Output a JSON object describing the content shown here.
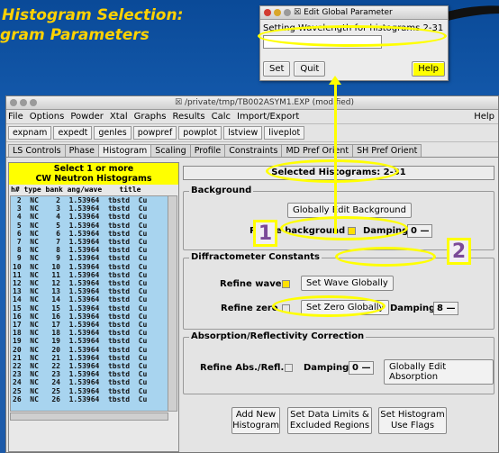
{
  "slide": {
    "title_line1": "Histogram Selection:",
    "title_line2": "gram Parameters"
  },
  "dialog": {
    "window_title": "Edit Global Parameter",
    "message": "Setting Wavelength for histograms 2-31",
    "input_value": "",
    "set_label": "Set",
    "quit_label": "Quit",
    "help_label": "Help"
  },
  "window": {
    "title": "/private/tmp/TB002ASYM1.EXP (modified)",
    "menu": [
      "File",
      "Options",
      "Powder",
      "Xtal",
      "Graphs",
      "Results",
      "Calc",
      "Import/Export"
    ],
    "help_menu": "Help",
    "toolbar": [
      "expnam",
      "expedt",
      "genles",
      "powpref",
      "powplot",
      "lstview",
      "liveplot"
    ],
    "tabs": [
      "LS Controls",
      "Phase",
      "Histogram",
      "Scaling",
      "Profile",
      "Constraints",
      "MD Pref Orient",
      "SH Pref Orient"
    ],
    "active_tab": "Histogram"
  },
  "histogram_list": {
    "header_line1": "Select 1 or more",
    "header_line2": "CW Neutron Histograms",
    "columns": "h# type bank ang/wave    title",
    "rows": [
      " 2  NC    2  1.53964  tbstd  Cu",
      " 3  NC    3  1.53964  tbstd  Cu",
      " 4  NC    4  1.53964  tbstd  Cu",
      " 5  NC    5  1.53964  tbstd  Cu",
      " 6  NC    6  1.53964  tbstd  Cu",
      " 7  NC    7  1.53964  tbstd  Cu",
      " 8  NC    8  1.53964  tbstd  Cu",
      " 9  NC    9  1.53964  tbstd  Cu",
      "10  NC   10  1.53964  tbstd  Cu",
      "11  NC   11  1.53964  tbstd  Cu",
      "12  NC   12  1.53964  tbstd  Cu",
      "13  NC   13  1.53964  tbstd  Cu",
      "14  NC   14  1.53964  tbstd  Cu",
      "15  NC   15  1.53964  tbstd  Cu",
      "16  NC   16  1.53964  tbstd  Cu",
      "17  NC   17  1.53964  tbstd  Cu",
      "18  NC   18  1.53964  tbstd  Cu",
      "19  NC   19  1.53964  tbstd  Cu",
      "20  NC   20  1.53964  tbstd  Cu",
      "21  NC   21  1.53964  tbstd  Cu",
      "22  NC   22  1.53964  tbstd  Cu",
      "23  NC   23  1.53964  tbstd  Cu",
      "24  NC   24  1.53964  tbstd  Cu",
      "25  NC   25  1.53964  tbstd  Cu",
      "26  NC   26  1.53964  tbstd  Cu"
    ]
  },
  "panel": {
    "selected": "Selected Histograms: 2-31",
    "background": {
      "legend": "Background",
      "edit_button": "Globally Edit Background",
      "refine_label": "Refine background",
      "damping_label": "Damping",
      "damping_value": "0"
    },
    "diffractometer": {
      "legend": "Diffractometer Constants",
      "refine_wave": "Refine wave",
      "set_wave_button": "Set Wave Globally",
      "refine_zero": "Refine zero",
      "set_zero_button": "Set Zero Globally",
      "damping_label": "Damping",
      "damping_value": "8"
    },
    "absorption": {
      "legend": "Absorption/Reflectivity Correction",
      "refine_label": "Refine Abs./Refl.",
      "damping_label": "Damping",
      "damping_value": "0",
      "edit_button": "Globally Edit Absorption"
    },
    "bottom_buttons": {
      "add_new_1": "Add New",
      "add_new_2": "Histogram",
      "limits_1": "Set Data Limits &",
      "limits_2": "Excluded Regions",
      "flags_1": "Set Histogram",
      "flags_2": "Use Flags"
    }
  },
  "annotations": {
    "one": "1",
    "two": "2"
  },
  "colors": {
    "highlight": "#ffff00",
    "list_bg": "#a8d4ef",
    "callout_text": "#7b4a98"
  }
}
